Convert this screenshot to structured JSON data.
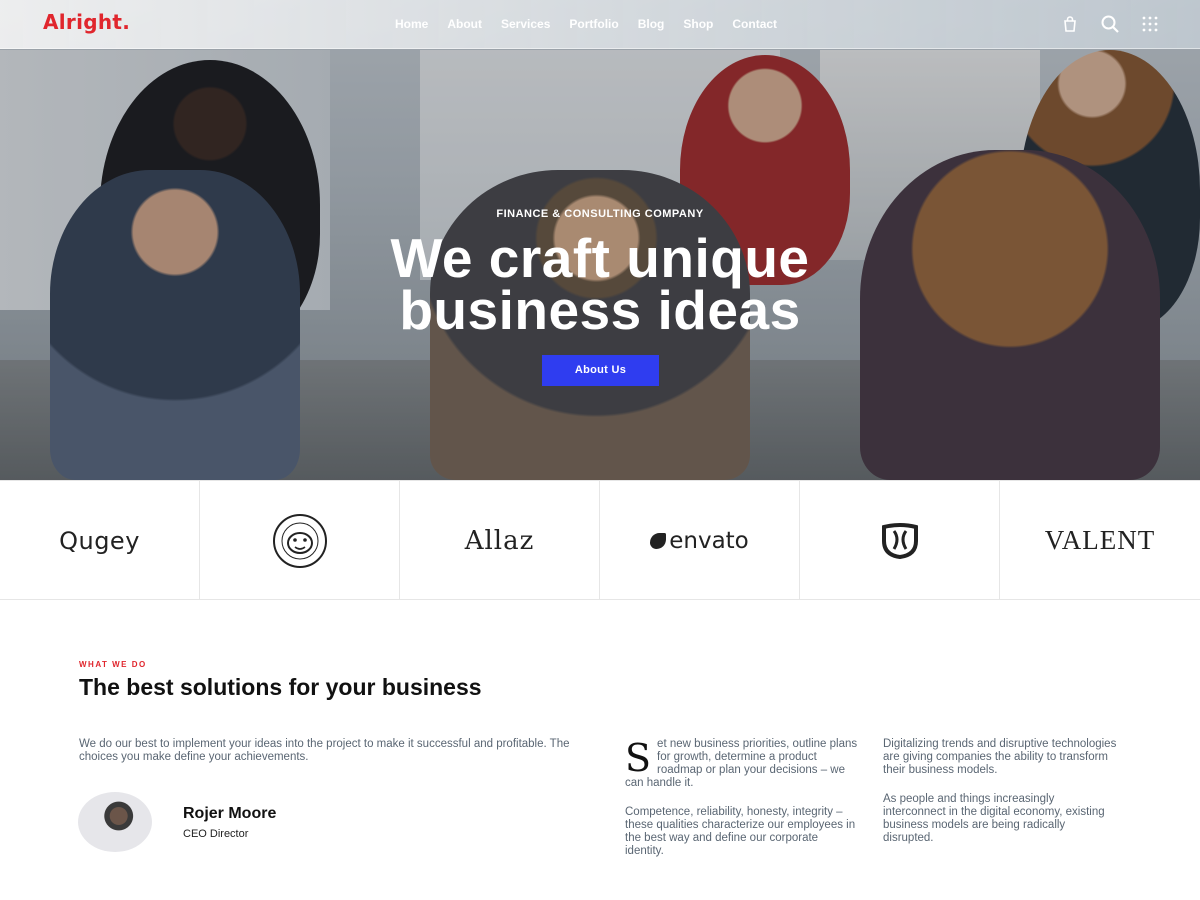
{
  "header": {
    "logo": "Alright.",
    "nav": [
      "Home",
      "About",
      "Services",
      "Portfolio",
      "Blog",
      "Shop",
      "Contact"
    ],
    "icons": [
      "bag-icon",
      "search-icon",
      "grid-menu-icon"
    ]
  },
  "hero": {
    "subtitle": "FINANCE & CONSULTING COMPANY",
    "title_line1": "We craft unique",
    "title_line2": "business ideas",
    "button": "About Us"
  },
  "brands": {
    "quqey": "Qugey",
    "bulldog": "bulldog-seal-logo",
    "allaz": "Allaz",
    "envato": "envato",
    "shield": "shield-mark-logo",
    "valent": "VALENT"
  },
  "what_we_do": {
    "eyebrow": "WHAT WE DO",
    "title": "The best solutions for your business",
    "intro": "We do our best to implement your ideas into the project to make it successful and profitable. The choices you make define your achievements.",
    "person": {
      "name": "Rojer Moore",
      "role": "CEO Director"
    },
    "col2": {
      "dropcap": "S",
      "p1_rest": "et new business priorities, outline plans for growth, determine a product roadmap or plan your decisions – we can handle it.",
      "p2": "Competence, reliability, honesty, integrity – these qualities characterize our employees in the best way and define our corporate identity."
    },
    "col3": {
      "p1": "Digitalizing trends and disruptive technologies are giving companies the ability to transform their business models.",
      "p2": "As people and things increasingly interconnect in the digital economy, existing business models are being radically disrupted."
    }
  },
  "colors": {
    "accent": "#e0262d",
    "button": "#2f3df0"
  }
}
